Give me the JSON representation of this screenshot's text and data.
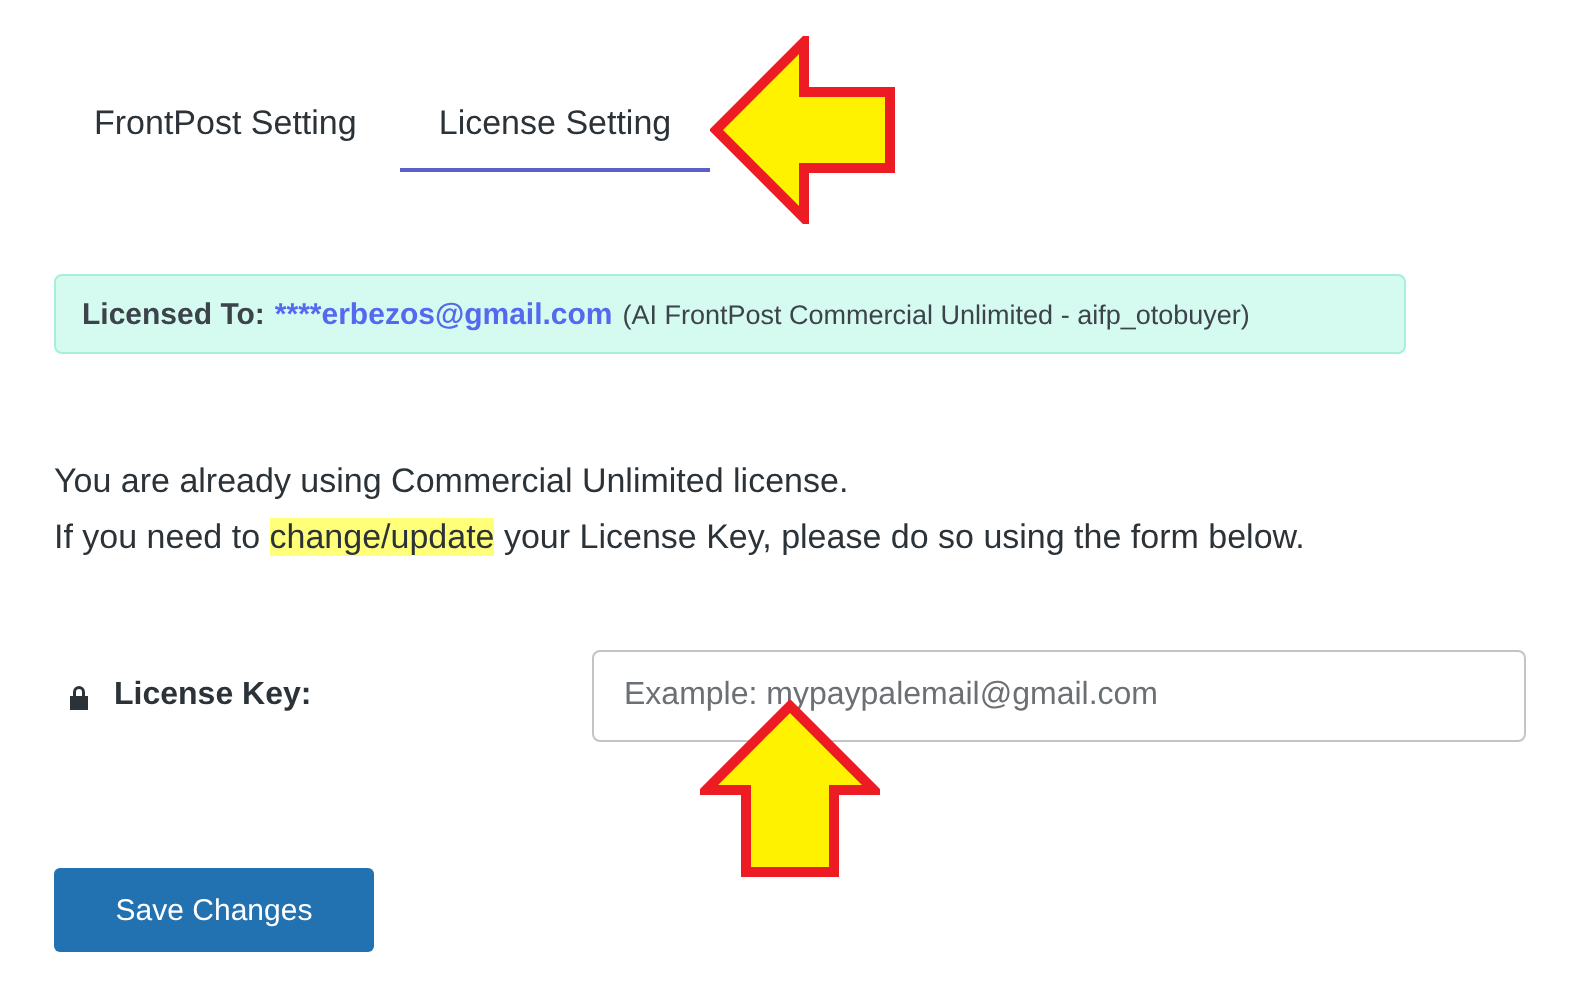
{
  "tabs": [
    {
      "label": "FrontPost Setting",
      "selected": false
    },
    {
      "label": "License Setting",
      "selected": true
    }
  ],
  "license_notice": {
    "label": "Licensed To:",
    "email": "****erbezos@gmail.com",
    "plan": "(AI FrontPost Commercial Unlimited - aifp_otobuyer)"
  },
  "message": {
    "line_1": "You are already using Commercial Unlimited license.",
    "line_2_before": "If you need to ",
    "line_2_highlight": "change/update",
    "line_2_after": " your License Key, please do so using the form below."
  },
  "license_key": {
    "label": "License Key:",
    "placeholder": "Example: mypaypalemail@gmail.com"
  },
  "buttons": [
    "Save Changes"
  ]
}
